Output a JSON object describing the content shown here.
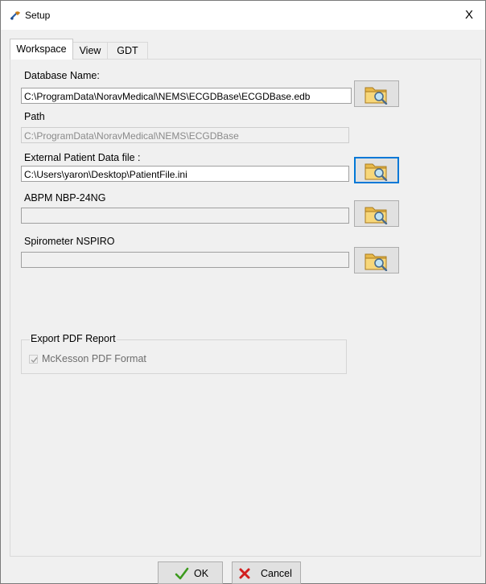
{
  "window": {
    "title": "Setup",
    "close_glyph": "X",
    "title_icon": "app-tool-icon"
  },
  "tabs": [
    {
      "label": "Workspace",
      "active": true
    },
    {
      "label": "View",
      "active": false
    },
    {
      "label": "GDT",
      "active": false
    }
  ],
  "workspace": {
    "database_name": {
      "label": "Database Name:",
      "value": "C:\\ProgramData\\NoravMedical\\NEMS\\ECGDBase\\ECGDBase.edb",
      "browse_icon": "folder-search-icon"
    },
    "path": {
      "label": "Path",
      "value": "C:\\ProgramData\\NoravMedical\\NEMS\\ECGDBase"
    },
    "external_patient": {
      "label": "External Patient Data file  :",
      "value": "C:\\Users\\yaron\\Desktop\\PatientFile.ini",
      "browse_icon": "folder-search-icon"
    },
    "abpm": {
      "label": "ABPM NBP-24NG",
      "value": "",
      "browse_icon": "folder-search-icon"
    },
    "spirometer": {
      "label": "Spirometer NSPIRO",
      "value": "",
      "browse_icon": "folder-search-icon"
    },
    "export_pdf": {
      "group_label": "Export PDF Report",
      "checkbox_label": "McKesson PDF Format",
      "checked": true,
      "enabled": false
    }
  },
  "buttons": {
    "ok": {
      "label": "OK",
      "icon": "checkmark-icon"
    },
    "cancel": {
      "label": "Cancel",
      "icon": "red-x-icon"
    }
  },
  "colors": {
    "focus_accent": "#0078d7",
    "ok_check": "#3c9a1e",
    "cancel_x": "#d11f1f"
  }
}
